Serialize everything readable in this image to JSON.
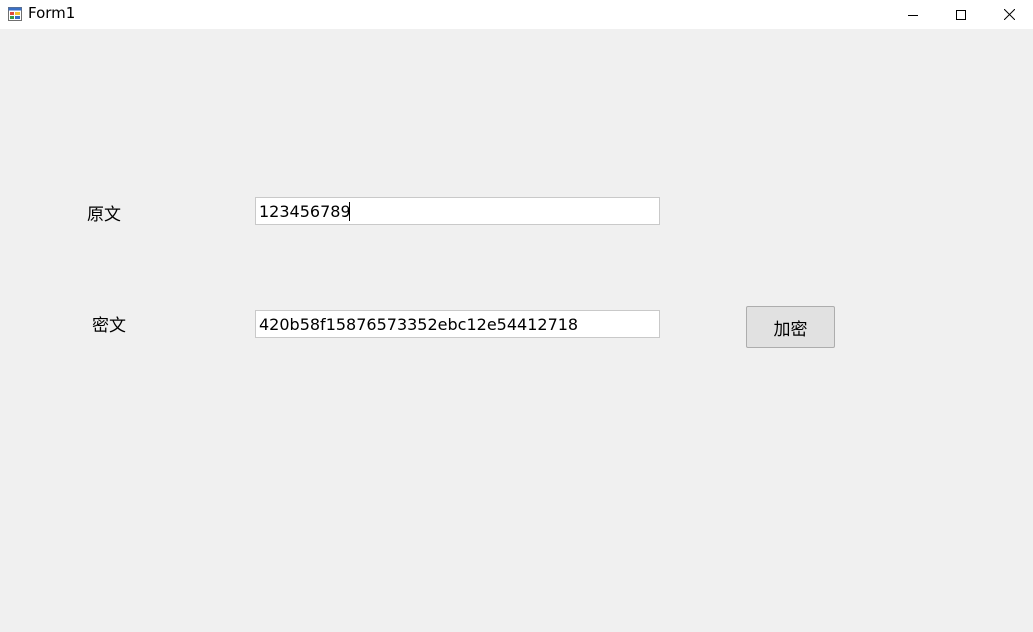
{
  "window": {
    "title": "Form1"
  },
  "form": {
    "plaintext_label": "原文",
    "plaintext_value": "123456789",
    "ciphertext_label": "密文",
    "ciphertext_value": "420b58f15876573352ebc12e54412718",
    "encrypt_button_label": "加密"
  },
  "icons": {
    "app": "form-app-icon",
    "minimize": "minimize-icon",
    "maximize": "maximize-icon",
    "close": "close-icon"
  },
  "colors": {
    "background": "#f0f0f0",
    "titlebar": "#ffffff",
    "textbox_border": "#c9c9c9",
    "button_face": "#e1e1e1",
    "button_border": "#adadad"
  }
}
